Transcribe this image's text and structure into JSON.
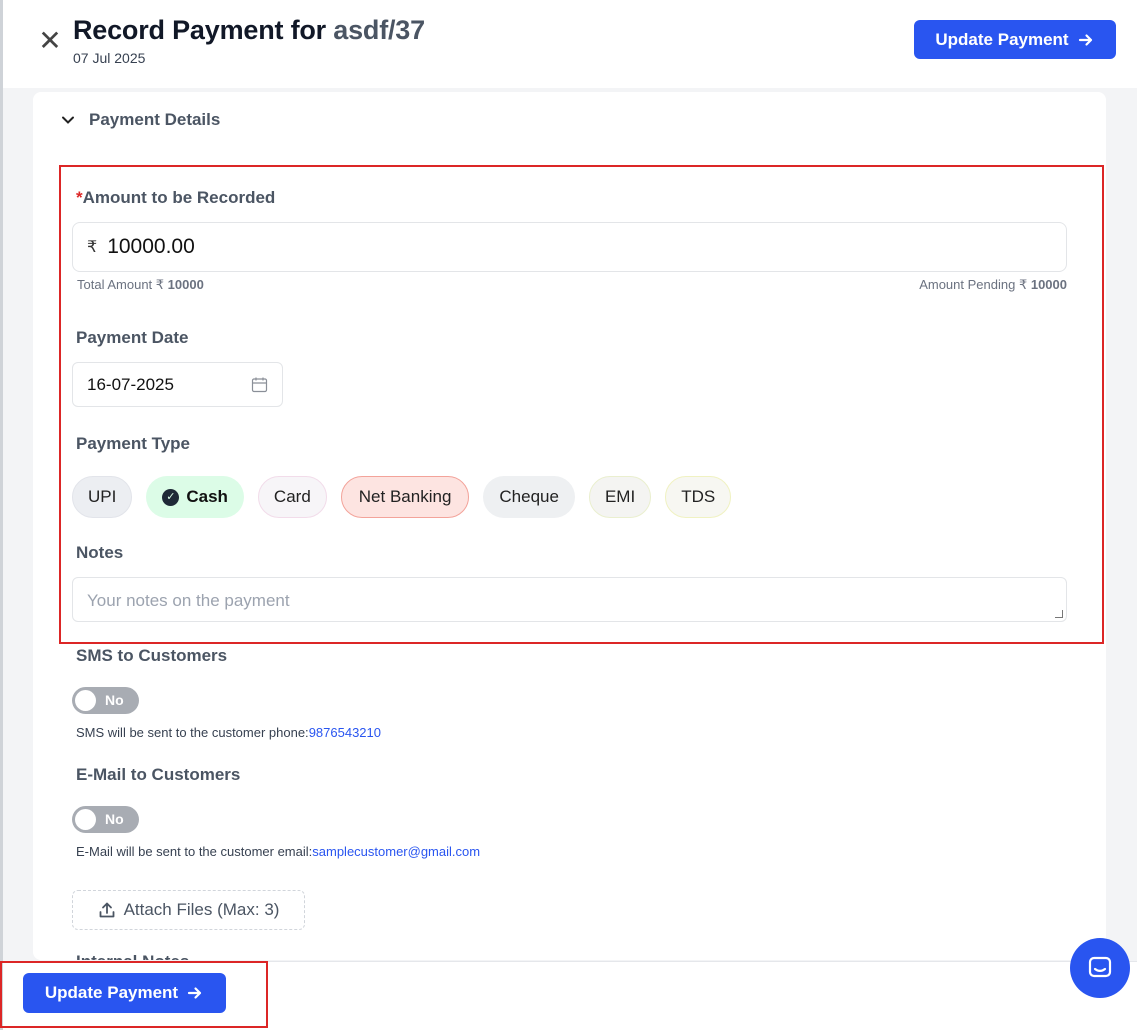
{
  "header": {
    "title_prefix": "Record Payment for",
    "title_ref": "asdf/37",
    "date": "07 Jul 2025",
    "update_label": "Update Payment"
  },
  "section": {
    "title": "Payment Details"
  },
  "amount": {
    "label": "Amount to be Recorded",
    "required_mark": "*",
    "currency": "₹",
    "value": "10000.00",
    "total_label": "Total Amount ₹",
    "total_value": "10000",
    "pending_label": "Amount Pending ₹",
    "pending_value": "10000"
  },
  "payment_date": {
    "label": "Payment Date",
    "value": "16-07-2025"
  },
  "payment_type": {
    "label": "Payment Type",
    "selected": "Cash",
    "options": [
      "UPI",
      "Cash",
      "Card",
      "Net Banking",
      "Cheque",
      "EMI",
      "TDS"
    ]
  },
  "notes": {
    "label": "Notes",
    "placeholder": "Your notes on the payment"
  },
  "sms": {
    "label": "SMS to Customers",
    "toggle_text": "No",
    "info_prefix": "SMS will be sent to the customer phone:",
    "phone": "9876543210"
  },
  "email": {
    "label": "E-Mail to Customers",
    "toggle_text": "No",
    "info_prefix": "E-Mail will be sent to the customer email:",
    "address": "samplecustomer@gmail.com"
  },
  "attach": {
    "label": "Attach Files (Max: 3)"
  },
  "internal_notes": {
    "label": "Internal Notes"
  },
  "footer": {
    "update_label": "Update Payment"
  },
  "colors": {
    "accent": "#2955f0",
    "highlight": "#dc2626",
    "cash_bg": "#dcfce7"
  }
}
